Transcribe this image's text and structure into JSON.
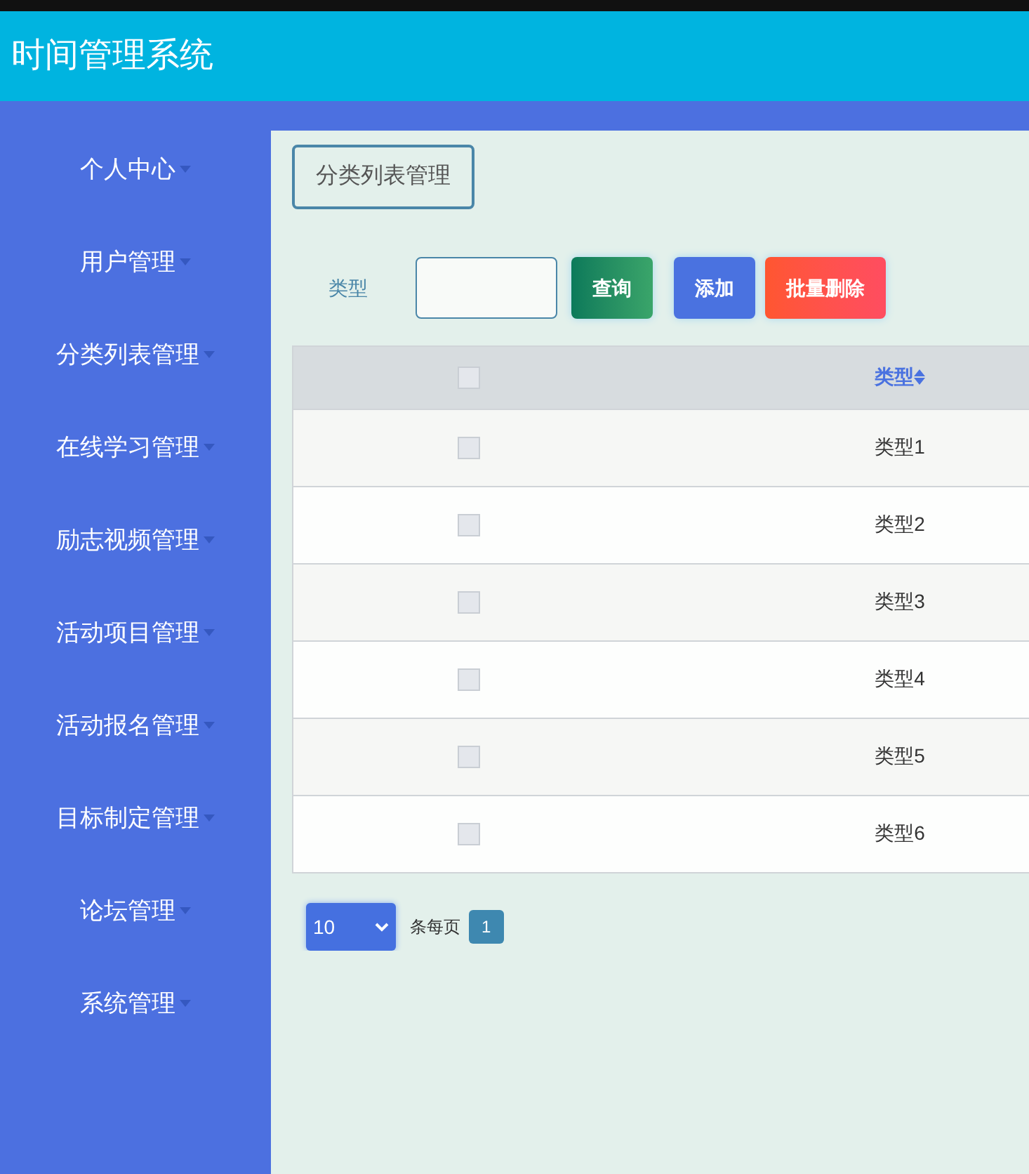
{
  "header": {
    "title": "时间管理系统"
  },
  "sidebar": {
    "items": [
      {
        "label": "个人中心"
      },
      {
        "label": "用户管理"
      },
      {
        "label": "分类列表管理"
      },
      {
        "label": "在线学习管理"
      },
      {
        "label": "励志视频管理"
      },
      {
        "label": "活动项目管理"
      },
      {
        "label": "活动报名管理"
      },
      {
        "label": "目标制定管理"
      },
      {
        "label": "论坛管理"
      },
      {
        "label": "系统管理"
      }
    ]
  },
  "breadcrumb": "分类列表管理",
  "search": {
    "label": "类型"
  },
  "buttons": [
    {
      "label": "查询",
      "kind": "search"
    },
    {
      "label": "添加",
      "kind": "add"
    },
    {
      "label": "批量删除",
      "kind": "delete"
    }
  ],
  "table": {
    "header_checked": false,
    "columns": [
      {
        "label": "类型"
      }
    ],
    "rows": [
      {
        "checked": false,
        "cells": [
          "类型1"
        ]
      },
      {
        "checked": false,
        "cells": [
          "类型2"
        ]
      },
      {
        "checked": false,
        "cells": [
          "类型3"
        ]
      },
      {
        "checked": false,
        "cells": [
          "类型4"
        ]
      },
      {
        "checked": false,
        "cells": [
          "类型5"
        ]
      },
      {
        "checked": false,
        "cells": [
          "类型6"
        ]
      }
    ]
  },
  "pagination": {
    "page_size": "10",
    "page_size_label": "条每页",
    "pages": [
      {
        "label": "1",
        "selected": true
      }
    ]
  }
}
